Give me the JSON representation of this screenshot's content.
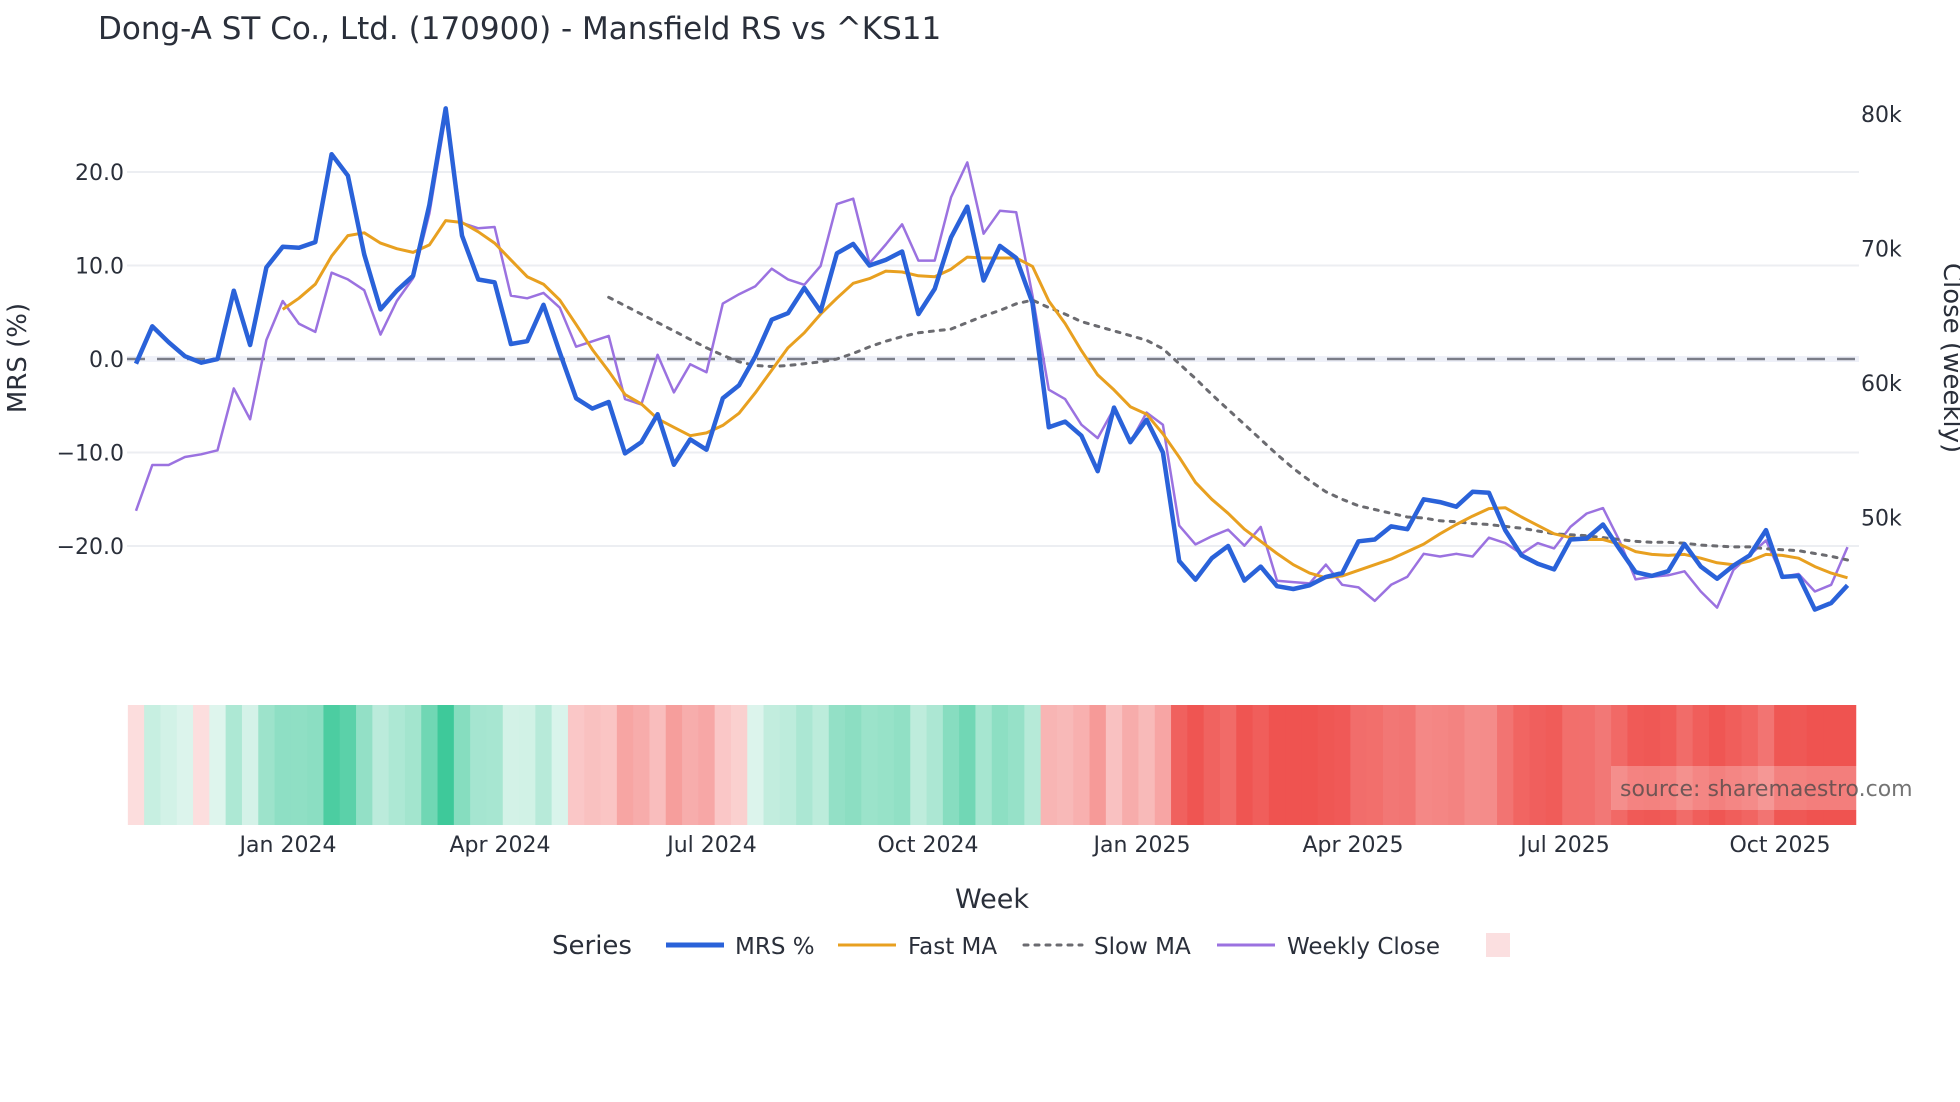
{
  "chart_data": {
    "type": "line",
    "title": "Dong-A ST Co., Ltd. (170900) - Mansfield RS vs ^KS11",
    "xlabel": "Week",
    "ylabel": "MRS (%)",
    "y2label": "Close (weekly)",
    "x_ticks": [
      "Jan 2024",
      "Apr 2024",
      "Jul 2024",
      "Oct 2024",
      "Jan 2025",
      "Apr 2025",
      "Jul 2025",
      "Oct 2025"
    ],
    "y_ticks": [
      "20.0",
      "10.0",
      "0.0",
      "−10.0",
      "−20.0"
    ],
    "y_tick_values": [
      20,
      10,
      0,
      -10,
      -20
    ],
    "y2_ticks": [
      "80k",
      "70k",
      "60k",
      "50k"
    ],
    "y2_tick_values": [
      80,
      70,
      60,
      50
    ],
    "grid": true,
    "legend_title": "Series",
    "legend_position": "bottom",
    "watermark": "source: sharemaestro.com",
    "colors": {
      "mrs": "#2a62d9",
      "fast": "#e8a020",
      "slow": "#6b6b70",
      "close": "#9b72e0",
      "zero": "#7a7d88",
      "pos": "#3ec99a",
      "neg": "#ef5350"
    },
    "series": [
      {
        "name": "MRS %",
        "key": "mrs",
        "start": 0,
        "values": [
          -0.5,
          3.5,
          1.8,
          0.3,
          -0.4,
          0,
          7.3,
          1.5,
          9.8,
          12.0,
          11.9,
          12.5,
          21.9,
          19.6,
          11.2,
          5.3,
          7.3,
          8.9,
          16.5,
          26.8,
          13.2,
          8.5,
          8.2,
          1.6,
          1.9,
          5.8,
          0.7,
          -4.2,
          -5.3,
          -4.6,
          -10.1,
          -8.9,
          -5.9,
          -11.3,
          -8.6,
          -9.7,
          -4.2,
          -2.8,
          0.3,
          4.2,
          4.9,
          7.6,
          5.1,
          11.3,
          12.3,
          10.0,
          10.6,
          11.5,
          4.8,
          7.5,
          13.0,
          16.3,
          8.4,
          12.1,
          10.8,
          6.0,
          -7.3,
          -6.7,
          -8.2,
          -12.0,
          -5.2,
          -8.9,
          -6.5,
          -10.0,
          -21.6,
          -23.6,
          -21.3,
          -20.0,
          -23.7,
          -22.2,
          -24.3,
          -24.6,
          -24.2,
          -23.3,
          -22.9,
          -19.5,
          -19.3,
          -17.9,
          -18.2,
          -15.0,
          -15.3,
          -15.8,
          -14.2,
          -14.3,
          -18.3,
          -21.0,
          -21.9,
          -22.5,
          -19.3,
          -19.2,
          -17.7,
          -20.3,
          -22.8,
          -23.2,
          -22.7,
          -19.8,
          -22.2,
          -23.5,
          -22.1,
          -21.0,
          -18.3,
          -23.3,
          -23.2,
          -26.8,
          -26.1,
          -24.2
        ]
      },
      {
        "name": "Fast MA",
        "key": "fast",
        "start": 9,
        "values": [
          5.3,
          6.5,
          8.0,
          11.0,
          13.2,
          13.5,
          12.4,
          11.8,
          11.4,
          12.2,
          14.8,
          14.6,
          13.6,
          12.4,
          10.6,
          8.8,
          8.0,
          6.3,
          3.7,
          1.0,
          -1.3,
          -3.8,
          -4.8,
          -6.4,
          -7.3,
          -8.2,
          -7.9,
          -7.1,
          -5.8,
          -3.6,
          -1.2,
          1.2,
          2.8,
          4.8,
          6.5,
          8.1,
          8.6,
          9.4,
          9.3,
          8.9,
          8.8,
          9.6,
          10.9,
          10.8,
          10.8,
          10.8,
          9.9,
          6.2,
          3.8,
          0.9,
          -1.7,
          -3.3,
          -5.1,
          -5.9,
          -8.0,
          -10.5,
          -13.2,
          -15.0,
          -16.5,
          -18.2,
          -19.5,
          -20.8,
          -22.0,
          -22.9,
          -23.4,
          -23.2,
          -22.6,
          -22.0,
          -21.4,
          -20.6,
          -19.8,
          -18.7,
          -17.7,
          -16.8,
          -16.0,
          -15.9,
          -16.9,
          -17.8,
          -18.7,
          -19.1,
          -19.3,
          -19.3,
          -19.8,
          -20.6,
          -20.9,
          -21.0,
          -20.9,
          -21.3,
          -21.8,
          -22.0,
          -21.6,
          -20.9,
          -21.0,
          -21.3,
          -22.2,
          -22.9,
          -23.4
        ]
      },
      {
        "name": "Slow MA",
        "key": "slow",
        "start": 29,
        "values": [
          6.6,
          5.7,
          4.8,
          3.9,
          3.0,
          2.1,
          1.2,
          0.4,
          -0.3,
          -0.7,
          -0.8,
          -0.7,
          -0.5,
          -0.3,
          0.0,
          0.6,
          1.3,
          1.9,
          2.4,
          2.8,
          3.0,
          3.2,
          3.9,
          4.6,
          5.2,
          5.9,
          6.3,
          5.5,
          4.8,
          4.0,
          3.5,
          3.0,
          2.5,
          2.0,
          1.1,
          -0.5,
          -2.1,
          -3.8,
          -5.4,
          -7.0,
          -8.6,
          -10.2,
          -11.7,
          -13.0,
          -14.2,
          -15.0,
          -15.7,
          -16.1,
          -16.5,
          -16.9,
          -17.0,
          -17.3,
          -17.4,
          -17.6,
          -17.7,
          -17.9,
          -18.1,
          -18.4,
          -18.7,
          -18.8,
          -18.9,
          -19.1,
          -19.3,
          -19.5,
          -19.6,
          -19.6,
          -19.7,
          -19.9,
          -20.0,
          -20.1,
          -20.1,
          -20.3,
          -20.4,
          -20.5,
          -20.8,
          -21.1,
          -21.5
        ]
      },
      {
        "name": "Weekly Close",
        "key": "close",
        "axis": "y2",
        "unit": "k KRW",
        "start": 0,
        "values": [
          50.5,
          53.9,
          53.9,
          54.5,
          54.7,
          55.0,
          59.6,
          57.3,
          63.2,
          66.1,
          64.4,
          63.8,
          68.2,
          67.7,
          66.9,
          63.6,
          66.1,
          67.8,
          72.6,
          79.9,
          71.9,
          71.5,
          71.6,
          66.5,
          66.3,
          66.7,
          65.6,
          62.7,
          63.1,
          63.5,
          58.8,
          58.4,
          62.1,
          59.3,
          61.4,
          60.8,
          65.9,
          66.6,
          67.2,
          68.5,
          67.7,
          67.3,
          68.7,
          73.3,
          73.7,
          68.9,
          70.3,
          71.8,
          69.1,
          69.1,
          73.8,
          76.4,
          71.1,
          72.8,
          72.7,
          66.5,
          59.5,
          58.8,
          56.9,
          55.9,
          58.1,
          55.6,
          57.8,
          56.9,
          49.4,
          48.0,
          48.6,
          49.1,
          47.9,
          49.3,
          45.3,
          45.2,
          45.1,
          46.5,
          45.0,
          44.8,
          43.8,
          45.0,
          45.6,
          47.3,
          47.1,
          47.3,
          47.1,
          48.5,
          48.1,
          47.3,
          48.1,
          47.7,
          49.3,
          50.3,
          50.7,
          48.3,
          45.4,
          45.6,
          45.7,
          46.0,
          44.5,
          43.3,
          46.1,
          47.2,
          48.3,
          45.6,
          45.8,
          44.5,
          45.0,
          47.8
        ]
      }
    ]
  }
}
